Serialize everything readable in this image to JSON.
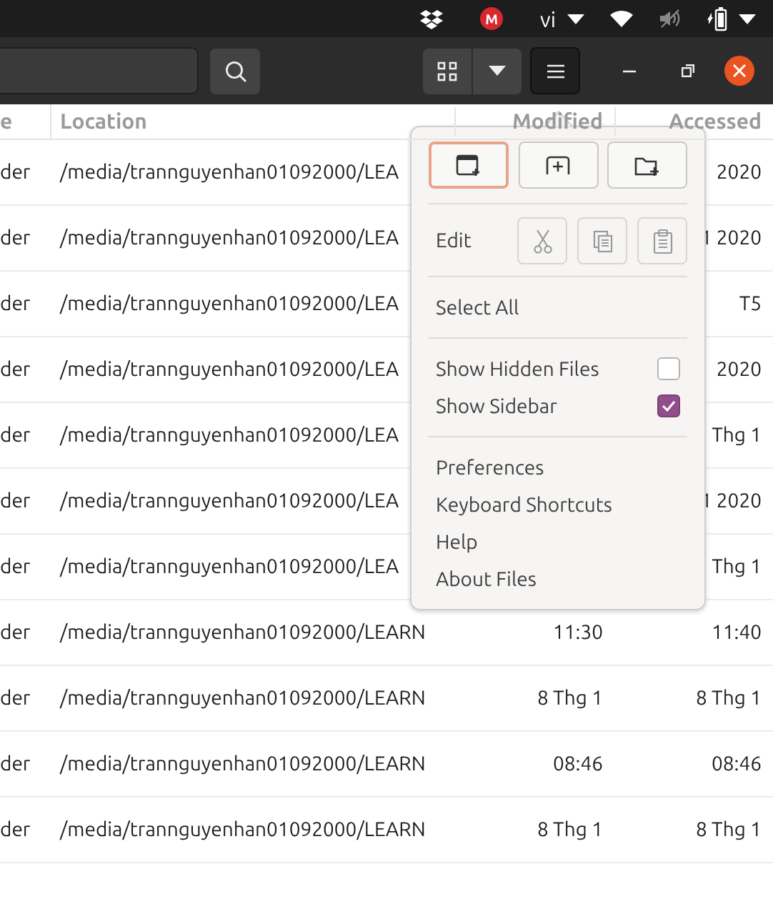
{
  "top_bar": {
    "mega_label": "M",
    "language": "vi"
  },
  "header_bar": {
    "view_selected": false,
    "menu_open": true
  },
  "table": {
    "columns": [
      "e",
      "Location",
      "Modified",
      "Accessed"
    ],
    "rows": [
      {
        "column_1": "der",
        "location": "/media/trannguyenhan01092000/LEA",
        "accessed": "2020"
      },
      {
        "column_1": "der",
        "location": "/media/trannguyenhan01092000/LEA",
        "accessed": "1 2020"
      },
      {
        "column_1": "der",
        "location": "/media/trannguyenhan01092000/LEA",
        "accessed": "T5"
      },
      {
        "column_1": "der",
        "location": "/media/trannguyenhan01092000/LEA",
        "accessed": "2020"
      },
      {
        "column_1": "der",
        "location": "/media/trannguyenhan01092000/LEA",
        "accessed": "Thg 1"
      },
      {
        "column_1": "der",
        "location": "/media/trannguyenhan01092000/LEA",
        "accessed": "1 2020"
      },
      {
        "column_1": "der",
        "location": "/media/trannguyenhan01092000/LEA",
        "accessed": "Thg 1"
      },
      {
        "column_1": "der",
        "location": "/media/trannguyenhan01092000/LEARN",
        "modified": "11:30",
        "accessed": "11:40"
      },
      {
        "column_1": "der",
        "location": "/media/trannguyenhan01092000/LEARN",
        "modified": "8 Thg 1",
        "accessed": "8 Thg 1"
      },
      {
        "column_1": "der",
        "location": "/media/trannguyenhan01092000/LEARN",
        "modified": "08:46",
        "accessed": "08:46"
      },
      {
        "column_1": "der",
        "location": "/media/trannguyenhan01092000/LEARN",
        "modified": "8 Thg 1",
        "accessed": "8 Thg 1"
      }
    ]
  },
  "menu": {
    "top_buttons": [
      {
        "kind": "new-window",
        "selected": true
      },
      {
        "kind": "new-tab",
        "selected": false
      },
      {
        "kind": "new-folder",
        "selected": false
      }
    ],
    "edit": {
      "label": "Edit",
      "buttons": [
        {
          "kind": "cut",
          "disabled": true
        },
        {
          "kind": "copy",
          "disabled": true
        },
        {
          "kind": "paste",
          "disabled": true
        }
      ]
    },
    "sections": [
      [
        {
          "label": "Select All"
        }
      ],
      [
        {
          "label": "Show Hidden Files",
          "checked": false
        },
        {
          "label": "Show Sidebar",
          "checked": true
        }
      ],
      [
        {
          "label": "Preferences"
        },
        {
          "label": "Keyboard Shortcuts"
        },
        {
          "label": "Help"
        },
        {
          "label": "About Files"
        }
      ]
    ]
  }
}
